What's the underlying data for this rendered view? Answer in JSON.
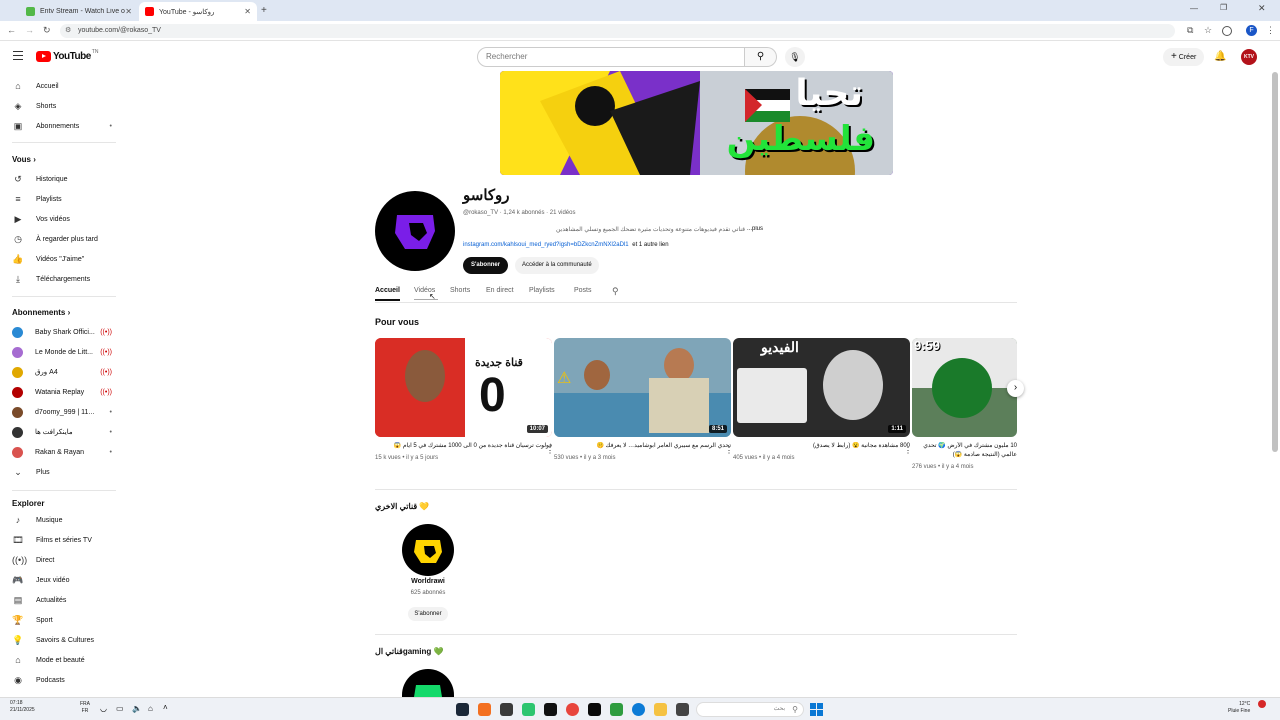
{
  "browser": {
    "tabs": [
      {
        "title": "Entv Stream - Watch Live on Ki",
        "active": false,
        "favicon_color": "#53b848"
      },
      {
        "title": "YouTube - روكاسو",
        "active": true,
        "favicon_color": "#ff0000"
      }
    ],
    "url": "youtube.com/@rokaso_TV"
  },
  "header": {
    "logo_text": "YouTube",
    "logo_sup": "TN",
    "search_placeholder": "Rechercher",
    "create_label": "Créer",
    "avatar_text": "KTV"
  },
  "sidebar": {
    "main": [
      {
        "label": "Accueil",
        "icon": "home-icon"
      },
      {
        "label": "Shorts",
        "icon": "shorts-icon"
      },
      {
        "label": "Abonnements",
        "icon": "subscriptions-icon"
      }
    ],
    "you_heading": "Vous",
    "you": [
      {
        "label": "Historique",
        "icon": "history-icon"
      },
      {
        "label": "Playlists",
        "icon": "playlist-icon"
      },
      {
        "label": "Vos vidéos",
        "icon": "your-videos-icon"
      },
      {
        "label": "À regarder plus tard",
        "icon": "watch-later-icon"
      },
      {
        "label": "Vidéos \"J'aime\"",
        "icon": "like-icon"
      },
      {
        "label": "Téléchargements",
        "icon": "download-icon"
      }
    ],
    "subs_heading": "Abonnements",
    "subs": [
      {
        "label": "Baby Shark Offici...",
        "status": "live",
        "color": "#2a8ad4"
      },
      {
        "label": "Le Monde de Litt...",
        "status": "live",
        "color": "#a66cd1"
      },
      {
        "label": "ورق A4",
        "status": "live",
        "color": "#e0a800"
      },
      {
        "label": "Watania Replay",
        "status": "live",
        "color": "#b30000"
      },
      {
        "label": "d7oomy_999 | 11...",
        "status": "dot",
        "color": "#7a4b2a"
      },
      {
        "label": "ماينكرافت ها",
        "status": "dot",
        "color": "#333333"
      },
      {
        "label": "Rakan & Rayan",
        "status": "dot",
        "color": "#d9534f"
      },
      {
        "label": "Plus",
        "status": "",
        "color": ""
      }
    ],
    "explore_heading": "Explorer",
    "explore": [
      {
        "label": "Musique",
        "icon": "music-icon"
      },
      {
        "label": "Films et séries TV",
        "icon": "film-icon"
      },
      {
        "label": "Direct",
        "icon": "live-icon"
      },
      {
        "label": "Jeux vidéo",
        "icon": "gaming-icon"
      },
      {
        "label": "Actualités",
        "icon": "news-icon"
      },
      {
        "label": "Sport",
        "icon": "trophy-icon"
      },
      {
        "label": "Savoirs & Cultures",
        "icon": "bulb-icon"
      },
      {
        "label": "Mode et beauté",
        "icon": "hanger-icon"
      },
      {
        "label": "Podcasts",
        "icon": "podcast-icon"
      }
    ]
  },
  "banner": {
    "text_line1": "تحيا",
    "text_line2": "فلسطين"
  },
  "channel": {
    "name": "روكاسو",
    "handle_line": "@rokaso_TV · 1,24 k abonnés · 21 vidéos",
    "description": "قناتي تقدم فيديوهات متنوعة وتحديات مثيرة تضحك الجميع وتسلي المشاهدين",
    "more": "...plus",
    "link": "instagram.com/kahlsoui_med_ryed?igsh=bDZkcnZmNXl2aDl1",
    "link_suffix": "et 1 autre lien",
    "subscribe": "S'abonner",
    "community": "Accéder à la communauté"
  },
  "tabs": [
    "Accueil",
    "Vidéos",
    "Shorts",
    "En direct",
    "Playlists",
    "Posts"
  ],
  "for_you": {
    "heading": "Pour vous",
    "videos": [
      {
        "title": "فولوت ترسيان قناة جديدة من 0 الى 1000 مشترك في 5 ايام 😱",
        "meta": "15 k vues • il y a 5 jours",
        "duration": "10:07",
        "bg": "#e8282b",
        "overlay": "0"
      },
      {
        "title": "تحدي الرسم مع سيبري العامر ابوشاميد… لا يعرفك 🤫",
        "meta": "530 vues • il y a 3 mois",
        "duration": "8:51",
        "bg": "#7fa5b8",
        "overlay": ""
      },
      {
        "title": "800 مشاهدة مجانية 😮 (رابط لا يصدق)",
        "meta": "405 vues • il y a 4 mois",
        "duration": "1:11",
        "bg": "#2b2b2b",
        "overlay": "الفيديو"
      },
      {
        "title": "10 مليون مشترك في الأرض 🌍 تحدي عالمي (النتيجة صادمة 😱)",
        "meta": "276 vues • il y a 4 mois",
        "duration": "9:59",
        "bg": "#5c7f5a",
        "overlay": ""
      }
    ]
  },
  "other_channel_section": {
    "heading": "قناتي الاخري 💛",
    "channel_name": "Worldrawi",
    "subs": "625 abonnés",
    "subscribe": "S'abonner"
  },
  "gaming_section": {
    "heading": "قناتي الgaming 💚"
  },
  "taskbar": {
    "time": "07:18",
    "date": "21/11/2025",
    "lang1": "FRA",
    "lang2": "FR",
    "search_placeholder": "بحث",
    "weather_temp": "12°C",
    "weather_desc": "Pluie Fine"
  }
}
